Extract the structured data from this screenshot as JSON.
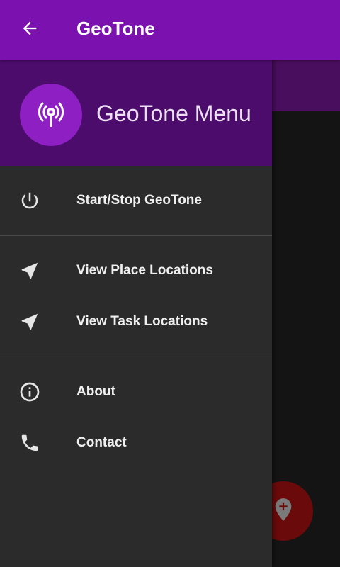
{
  "toolbar": {
    "title": "GeoTone",
    "back_icon": "arrow-back-icon"
  },
  "drawer": {
    "header": {
      "title": "GeoTone Menu",
      "logo_icon": "antenna-signal-icon"
    },
    "sections": [
      {
        "items": [
          {
            "label": "Start/Stop GeoTone",
            "icon": "power-icon"
          }
        ]
      },
      {
        "items": [
          {
            "label": "View Place Locations",
            "icon": "navigation-arrow-icon"
          },
          {
            "label": "View Task Locations",
            "icon": "navigation-arrow-icon"
          }
        ]
      },
      {
        "items": [
          {
            "label": "About",
            "icon": "info-icon"
          },
          {
            "label": "Contact",
            "icon": "phone-icon"
          }
        ]
      }
    ]
  },
  "background": {
    "fab_icon": "add-location-icon"
  },
  "colors": {
    "toolbar": "#7b12b0",
    "drawer_header": "#4b0c6c",
    "drawer_body": "#2b2b2b",
    "logo_circle": "#8e1fc2"
  }
}
